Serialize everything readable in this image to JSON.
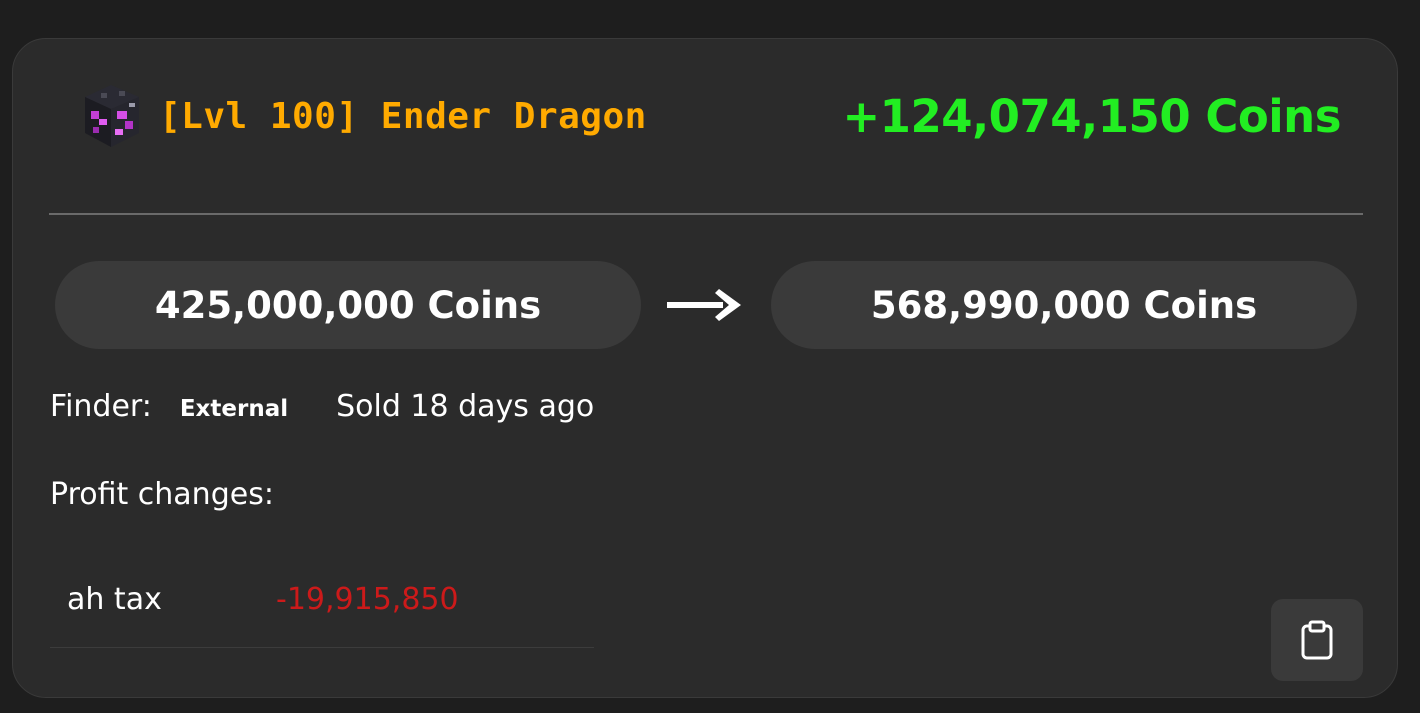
{
  "flip": {
    "item_name": "[Lvl 100] Ender Dragon",
    "item_color": "#ffaa00",
    "item_icon": "ender-dragon-pet-icon",
    "profit": "+124,074,150 Coins",
    "profit_color": "#22ee22",
    "buy_price": "425,000,000 Coins",
    "sell_price": "568,990,000 Coins",
    "arrow_icon": "arrow-right-icon",
    "finder_label": "Finder:",
    "finder_value": "External",
    "sold_text": "Sold 18 days ago",
    "profit_changes_label": "Profit changes:",
    "profit_changes": [
      {
        "label": "ah tax",
        "value": "-19,915,850",
        "color": "#cc1a1a"
      }
    ],
    "copy_icon": "clipboard-icon"
  }
}
